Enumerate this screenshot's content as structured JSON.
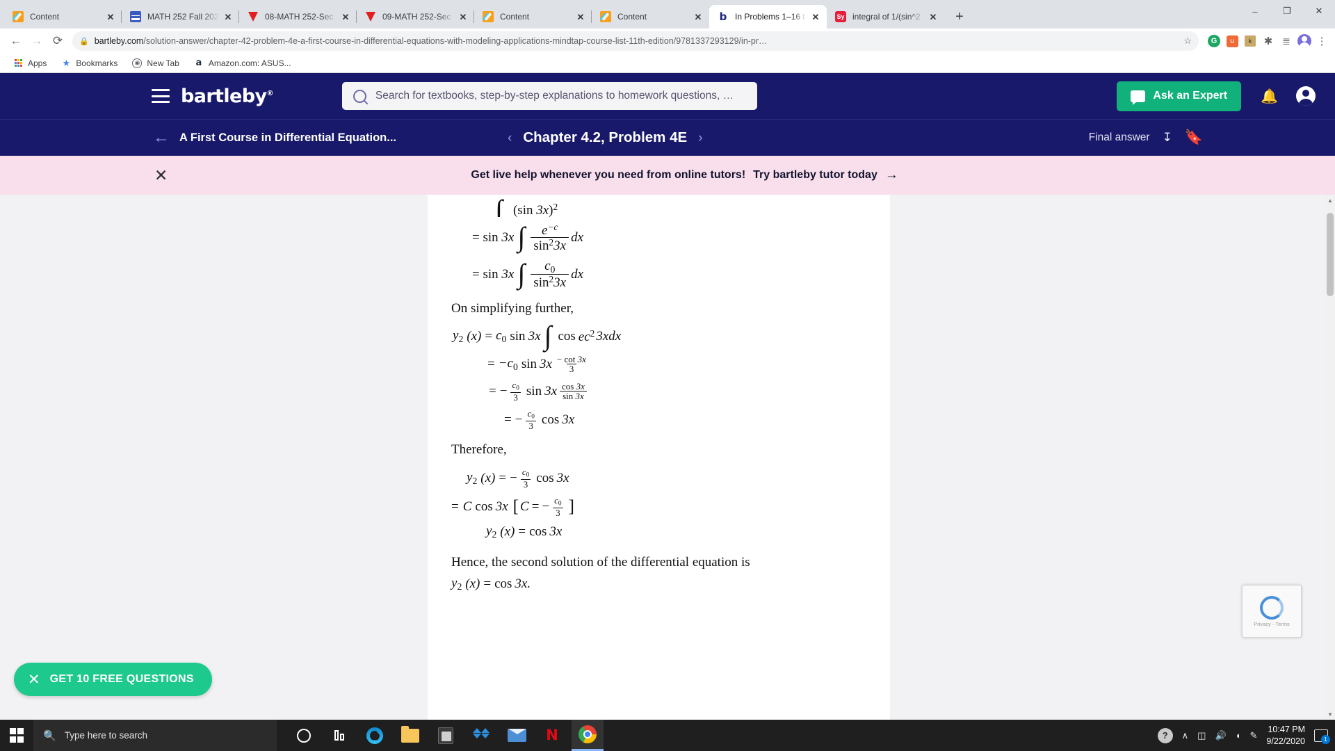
{
  "browser": {
    "tabs": [
      {
        "title": "Content",
        "favicon": "content-icon",
        "active": false
      },
      {
        "title": "MATH 252 Fall 202",
        "favicon": "sheets-icon",
        "active": false
      },
      {
        "title": "08-MATH 252-Sec",
        "favicon": "video-icon",
        "active": false
      },
      {
        "title": "09-MATH 252-Sec",
        "favicon": "video-icon",
        "active": false
      },
      {
        "title": "Content",
        "favicon": "content-icon",
        "active": false
      },
      {
        "title": "Content",
        "favicon": "content-icon",
        "active": false
      },
      {
        "title": "In Problems 1–16 t",
        "favicon": "bartleby-icon",
        "active": true
      },
      {
        "title": "integral of 1/(sin^2",
        "favicon": "symbolab-icon",
        "active": false
      }
    ],
    "new_tab_label": "+",
    "window_controls": {
      "minimize": "–",
      "maximize": "❐",
      "close": "✕"
    },
    "nav": {
      "back": "←",
      "forward": "→",
      "reload": "⟳"
    },
    "omnibox": {
      "lock": "🔒",
      "domain": "bartleby.com",
      "path": "/solution-answer/chapter-42-problem-4e-a-first-course-in-differential-equations-with-modeling-applications-mindtap-course-list-11th-edition/9781337293129/in-pr…",
      "star": "☆"
    },
    "extensions": [
      {
        "name": "grammarly-extension-icon",
        "label": "G"
      },
      {
        "name": "ublock-extension-icon",
        "label": "u"
      },
      {
        "name": "kami-extension-icon",
        "label": "k"
      },
      {
        "name": "puzzle-extensions-icon",
        "label": "✱"
      },
      {
        "name": "reading-list-icon",
        "label": "≣"
      },
      {
        "name": "profile-avatar",
        "label": ""
      },
      {
        "name": "chrome-menu-icon",
        "label": "⋮"
      }
    ],
    "bookmarks": [
      {
        "label": "Apps",
        "icon": "apps-grid-icon"
      },
      {
        "label": "Bookmarks",
        "icon": "star-icon"
      },
      {
        "label": "New Tab",
        "icon": "globe-icon"
      },
      {
        "label": "Amazon.com: ASUS...",
        "icon": "amazon-icon"
      }
    ]
  },
  "site": {
    "logo": "bartleby",
    "logo_mark": "®",
    "menu_icon": "hamburger-menu-icon",
    "search": {
      "placeholder": "Search for textbooks, step-by-step explanations to homework questions, …",
      "icon": "search-icon"
    },
    "ask_expert": {
      "label": "Ask an Expert",
      "icon": "chat-bubble-icon"
    },
    "bell_icon": "notification-bell-icon",
    "account_icon": "account-avatar-icon",
    "subnav": {
      "back_icon": "←",
      "book_title": "A First Course in Differential Equation...",
      "prev_icon": "‹",
      "chapter_title": "Chapter 4.2, Problem 4E",
      "next_icon": "›",
      "final_answer_label": "Final answer",
      "download_icon": "download-icon",
      "bookmark_icon": "bookmark-icon"
    },
    "promo": {
      "close_icon": "✕",
      "text_bold": "Get live help whenever you need from online tutors!",
      "text_cta": "Try bartleby tutor today",
      "arrow": "→"
    },
    "cta": {
      "close_icon": "✕",
      "label": "GET 10 FREE QUESTIONS"
    },
    "recaptcha": {
      "line1": "Privacy",
      "sep": "-",
      "line2": "Terms"
    },
    "colors": {
      "navy": "#19196b",
      "green": "#11b17b",
      "promo_pink": "#f9dfec",
      "cta_green": "#1dc98c"
    }
  },
  "solution": {
    "line_partial": "(sin 3x)",
    "line_partial_sup": "2",
    "step1": {
      "lhs": "= sin 3x",
      "int": "∫",
      "num": "e",
      "num_sup": "−c",
      "den_a": "sin",
      "den_sup": "2",
      "den_b": "3x",
      "dx": "dx"
    },
    "step2": {
      "lhs": "= sin 3x",
      "int": "∫",
      "num": "c",
      "num_sub": "0",
      "den_a": "sin",
      "den_sup": "2",
      "den_b": "3x",
      "dx": "dx"
    },
    "heading1": "On simplifying further,",
    "step3": {
      "y": "y",
      "ysub": "2",
      "args": "(x) =",
      "c": "c",
      "csub": "0",
      "sin": "sin 3x",
      "int": "∫",
      "rest": "cos ec",
      "rest_sup": "2",
      "tail": "3xdx"
    },
    "step4": {
      "eq": "= −c",
      "sub": "0",
      "sin": "sin 3x",
      "num": "− cot 3x",
      "den": "3"
    },
    "step5": {
      "eq": "= −",
      "num1": "c",
      "num1sub": "0",
      "den1": "3",
      "sin": "sin 3x",
      "num2": "cos 3x",
      "den2": "sin 3x"
    },
    "step6": {
      "eq": "= −",
      "num": "c",
      "numsub": "0",
      "den": "3",
      "tail": "cos 3x"
    },
    "heading2": "Therefore,",
    "step7": {
      "y": "y",
      "ysub": "2",
      "args": "(x) = −",
      "num": "c",
      "numsub": "0",
      "den": "3",
      "tail": "cos 3x"
    },
    "step8": {
      "lhs": "= C cos 3x",
      "bracket_open": "[",
      "bracket_txt": "C = −",
      "num": "c",
      "numsub": "0",
      "den": "3",
      "bracket_close": "]"
    },
    "step9": {
      "y": "y",
      "ysub": "2",
      "rest": "(x) = cos 3x"
    },
    "conclusion": "Hence, the second solution of the differential equation is",
    "final": {
      "y": "y",
      "ysub": "2",
      "rest": "(x) = cos 3x."
    }
  },
  "taskbar": {
    "start_icon": "windows-start-icon",
    "search_placeholder": "Type here to search",
    "search_icon": "search-icon",
    "items": [
      {
        "name": "cortana-icon"
      },
      {
        "name": "task-view-icon"
      },
      {
        "name": "edge-icon"
      },
      {
        "name": "file-explorer-icon"
      },
      {
        "name": "microsoft-store-icon"
      },
      {
        "name": "dropbox-icon"
      },
      {
        "name": "mail-icon"
      },
      {
        "name": "netflix-icon",
        "label": "N"
      },
      {
        "name": "chrome-icon"
      }
    ],
    "tray": {
      "help_icon": "help-icon",
      "chevron": "∧",
      "battery_icon": "battery-icon",
      "volume_icon": "🔊",
      "wifi_icon": "wifi-icon",
      "pen_icon": "pen-icon",
      "time": "10:47 PM",
      "date": "9/22/2020",
      "notification_icon": "action-center-icon",
      "notification_count": "1"
    }
  }
}
